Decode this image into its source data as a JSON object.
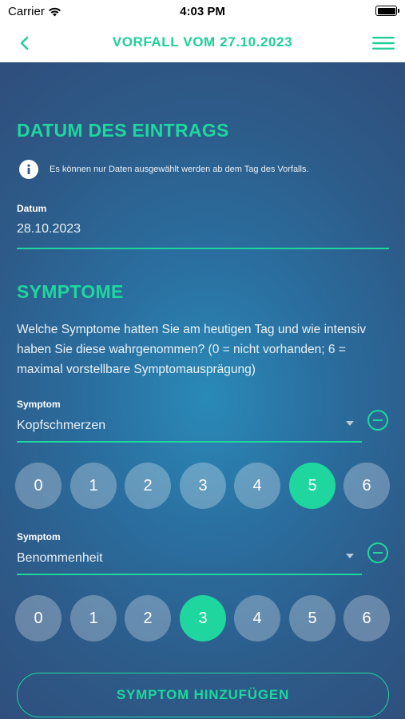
{
  "status_bar": {
    "carrier": "Carrier",
    "time": "4:03 PM"
  },
  "nav": {
    "title": "VORFALL VOM 27.10.2023"
  },
  "date_section": {
    "title": "DATUM DES EINTRAGS",
    "info": "Es können nur Daten ausgewählt werden ab dem Tag des Vorfalls.",
    "label": "Datum",
    "value": "28.10.2023"
  },
  "symptoms_section": {
    "title": "SYMPTOME",
    "question": "Welche Symptome hatten Sie am heutigen Tag und wie intensiv haben Sie diese wahrgenommen? (0 = nicht vorhanden; 6 = maximal vorstellbare Symptomausprägung)",
    "symptoms": [
      {
        "label": "Symptom",
        "value": "Kopfschmerzen",
        "scale": [
          "0",
          "1",
          "2",
          "3",
          "4",
          "5",
          "6"
        ],
        "selected": 5
      },
      {
        "label": "Symptom",
        "value": "Benommenheit",
        "scale": [
          "0",
          "1",
          "2",
          "3",
          "4",
          "5",
          "6"
        ],
        "selected": 3
      }
    ],
    "add_button": "SYMPTOM HINZUFÜGEN"
  },
  "colors": {
    "accent": "#1fd69e",
    "background": "#2f5b86",
    "nav_bg": "#ffffff"
  },
  "icons": [
    "wifi-icon",
    "battery-icon",
    "back-chevron-icon",
    "hamburger-menu-icon",
    "info-icon",
    "dropdown-arrow-icon",
    "remove-circle-icon"
  ]
}
